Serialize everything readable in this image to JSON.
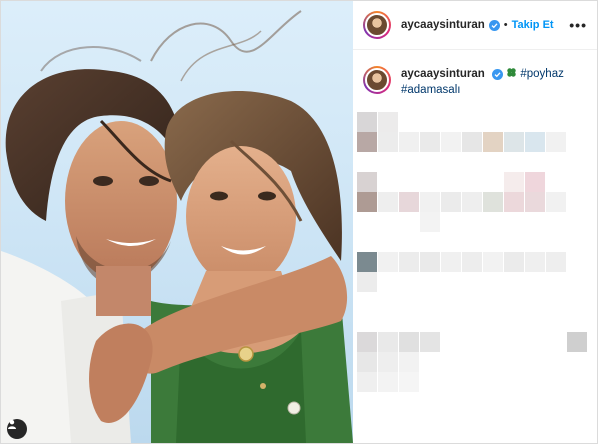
{
  "post": {
    "username": "aycaaysinturan",
    "follow_label": "Takip Et",
    "separator": "•",
    "more_label": "•••"
  },
  "caption": {
    "username": "aycaaysinturan",
    "emoji": "clover-icon",
    "hashtags": [
      "#poyhaz",
      "#adamasalı"
    ]
  },
  "colors": {
    "accent": "#0095f6",
    "verified": "#3897f0",
    "hashtag": "#00376b",
    "text": "#262626"
  }
}
